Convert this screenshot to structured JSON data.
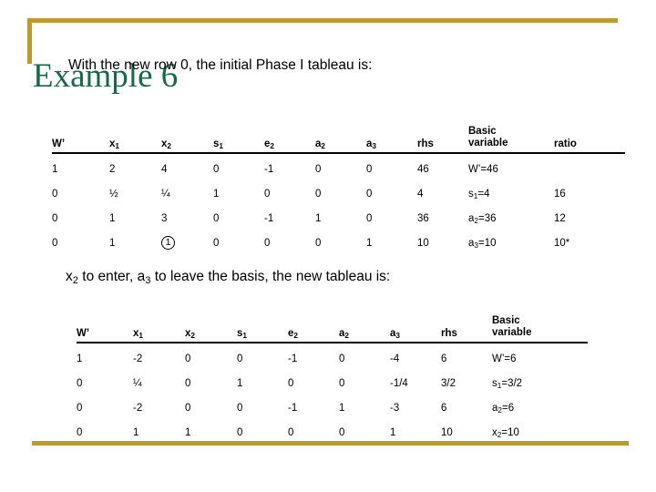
{
  "slide": {
    "title": "Example 6",
    "title_color": "#16684a",
    "accent_color": "#bd9a2c",
    "intro_text": "With the new row 0, the initial Phase I tableau is:",
    "middle_text_parts": {
      "a": "x",
      "a_sub": "2",
      "b": " to enter, a",
      "b_sub": "3",
      "c": " to leave the basis, the new tableau is:"
    }
  },
  "tableau_1": {
    "headers": [
      {
        "label": "W’",
        "sub": ""
      },
      {
        "label": "x",
        "sub": "1"
      },
      {
        "label": "x",
        "sub": "2"
      },
      {
        "label": "s",
        "sub": "1"
      },
      {
        "label": "e",
        "sub": "2"
      },
      {
        "label": "a",
        "sub": "2"
      },
      {
        "label": "a",
        "sub": "3"
      },
      {
        "label": "rhs",
        "sub": ""
      },
      {
        "label": "Basic variable",
        "sub": ""
      },
      {
        "label": "ratio",
        "sub": ""
      }
    ],
    "rows": [
      {
        "cells": [
          "1",
          "2",
          "4",
          "0",
          "-1",
          "0",
          "0",
          "46"
        ],
        "basic": {
          "var": "W’",
          "var_sub": "",
          "value": "46"
        },
        "ratio": ""
      },
      {
        "cells": [
          "0",
          "½",
          "¼",
          "1",
          "0",
          "0",
          "0",
          "4"
        ],
        "basic": {
          "var": "s",
          "var_sub": "1",
          "value": "4"
        },
        "ratio": "16"
      },
      {
        "cells": [
          "0",
          "1",
          "3",
          "0",
          "-1",
          "1",
          "0",
          "36"
        ],
        "basic": {
          "var": "a",
          "var_sub": "2",
          "value": "36"
        },
        "ratio": "12"
      },
      {
        "cells": [
          "0",
          "1",
          "1",
          "0",
          "0",
          "0",
          "1",
          "10"
        ],
        "pivot_col": 2,
        "basic": {
          "var": "a",
          "var_sub": "3",
          "value": "10"
        },
        "ratio": "10*"
      }
    ]
  },
  "tableau_2": {
    "headers": [
      {
        "label": "W’",
        "sub": ""
      },
      {
        "label": "x",
        "sub": "1"
      },
      {
        "label": "x",
        "sub": "2"
      },
      {
        "label": "s",
        "sub": "1"
      },
      {
        "label": "e",
        "sub": "2"
      },
      {
        "label": "a",
        "sub": "2"
      },
      {
        "label": "a",
        "sub": "3"
      },
      {
        "label": "rhs",
        "sub": ""
      },
      {
        "label": "Basic variable",
        "sub": ""
      }
    ],
    "rows": [
      {
        "cells": [
          "1",
          "-2",
          "0",
          "0",
          "-1",
          "0",
          "-4",
          "6"
        ],
        "basic": {
          "var": "W’",
          "var_sub": "",
          "value": "6"
        }
      },
      {
        "cells": [
          "0",
          "¼",
          "0",
          "1",
          "0",
          "0",
          "-1/4",
          "3/2"
        ],
        "basic": {
          "var": "s",
          "var_sub": "1",
          "value": "3/2"
        }
      },
      {
        "cells": [
          "0",
          "-2",
          "0",
          "0",
          "-1",
          "1",
          "-3",
          "6"
        ],
        "basic": {
          "var": "a",
          "var_sub": "2",
          "value": "6"
        }
      },
      {
        "cells": [
          "0",
          "1",
          "1",
          "0",
          "0",
          "0",
          "1",
          "10"
        ],
        "basic": {
          "var": "x",
          "var_sub": "2",
          "value": "10"
        }
      }
    ]
  }
}
